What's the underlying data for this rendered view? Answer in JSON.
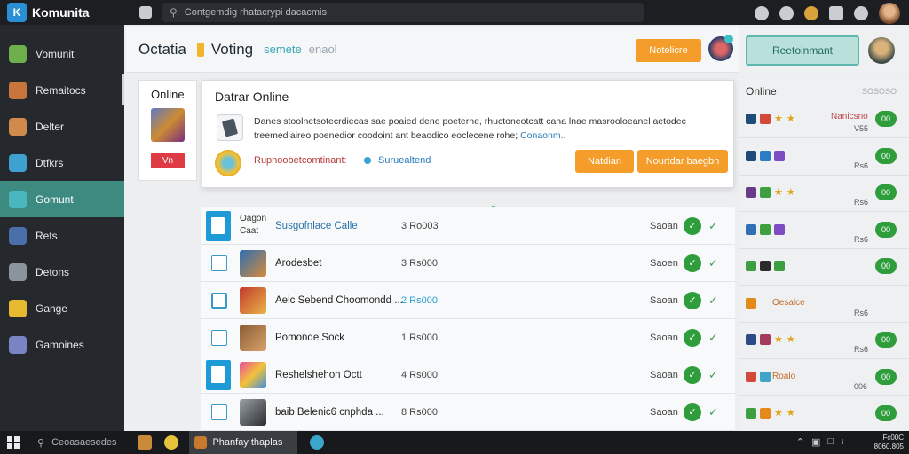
{
  "app": {
    "name": "Komunita"
  },
  "search": {
    "placeholder": "Contgemdig rhatacrypi dacacmis"
  },
  "sidebar": {
    "items": [
      {
        "label": "Vomunit",
        "color": "#6fae4d"
      },
      {
        "label": "Remaitocs",
        "color": "#c7753b"
      },
      {
        "label": "Delter",
        "color": "#d08a4b"
      },
      {
        "label": "Dtfkrs",
        "color": "#3fa1d0"
      },
      {
        "label": "Gomunt",
        "color": "#49b6c0",
        "active": true
      },
      {
        "label": "Rets",
        "color": "#4b6fa8"
      },
      {
        "label": "Detons",
        "color": "#8b949c"
      },
      {
        "label": "Gange",
        "color": "#e6b92e"
      },
      {
        "label": "Gamoines",
        "color": "#7a84c5"
      }
    ]
  },
  "header": {
    "title": "Octatia",
    "section": "Voting",
    "link": "semete",
    "subtext": "enaol",
    "button": "Notelicre"
  },
  "right_top": {
    "button": "Reetoinmant"
  },
  "online_card": {
    "title": "Online",
    "button": "Vn"
  },
  "dialog": {
    "title": "Datrar Online",
    "body": "Danes stoolnetsotecrdiecas sae poaied dene poeterne, rhuctoneotcatt cana lnae masrooloeanel aetodec treemedlaireo poenedior coodoint ant beaodico eoclecene rohe;",
    "link_text": "Conaonm..",
    "note": "Rupnoobetcomtinant:",
    "note_link": "Suruealtend",
    "btn_primary": "Natdian",
    "btn_secondary": "Nourtdar baegbn"
  },
  "list": {
    "rows": [
      {
        "thumb_text": "Oagon\nCaat",
        "name": "Susgofnlace Calle",
        "size": "3 Ro003",
        "status": "Saoan",
        "checkbox": "big",
        "name_blue": true
      },
      {
        "name": "Arodesbet",
        "size": "3 Rs000",
        "status": "Saoen",
        "checkbox": "small",
        "thumb": "linear-gradient(135deg,#2e6fb5,#d48a3b)"
      },
      {
        "name": "Aelc Sebend Choomondd ...",
        "size": "2 Rs000",
        "status": "Saoan",
        "checkbox": "small-thick",
        "size_blue": true,
        "thumb": "linear-gradient(135deg,#c23a2c,#e9b447)"
      },
      {
        "name": "Pomonde Sock",
        "size": "1 Rs000",
        "status": "Saoan",
        "checkbox": "small",
        "thumb": "linear-gradient(135deg,#8a5c34,#d9a36a)"
      },
      {
        "name": "Reshelshehon Octt",
        "size": "4 Rs000",
        "status": "Saoan",
        "checkbox": "big",
        "thumb": "linear-gradient(135deg,#e94e9c,#f3c23a,#3d8de0)"
      },
      {
        "name": "baib Belenic6 cnphda ...",
        "size": "8 Rs000",
        "status": "Saoan",
        "checkbox": "small",
        "thumb": "linear-gradient(135deg,#9aa0a6,#2a2d30)"
      }
    ]
  },
  "right_panel": {
    "title": "Online",
    "title_right": "SOSOSO",
    "rows": [
      {
        "icons": [
          "#1f4b7a",
          "#d34a38",
          "#e3a21a",
          "#e3a21a"
        ],
        "red": "Nanicsno",
        "small": "V55",
        "pill": "00"
      },
      {
        "icons": [
          "#1f4b7a",
          "#2c7bc5",
          "#7e4cc2"
        ],
        "small": "Rs6",
        "pill": "00"
      },
      {
        "icons": [
          "#6a3b8a",
          "#3d9f3f",
          "#e3a21a",
          "#e3a21a"
        ],
        "small": "Rs6",
        "pill": "00"
      },
      {
        "icons": [
          "#2e6fb5",
          "#3d9f3f",
          "#7e4cc2"
        ],
        "small": "Rs6",
        "pill": "00"
      },
      {
        "icons": [
          "#3d9f3f",
          "#2b2b2b",
          "#3d9f3f"
        ],
        "small": "",
        "pill": "00"
      },
      {
        "icons": [
          "#e38a1a"
        ],
        "label": "Oesalce",
        "small": "Rs6",
        "pill": ""
      },
      {
        "icons": [
          "#2e4a88",
          "#a43a5c",
          "#e3a21a",
          "#e3a21a"
        ],
        "small": "Rs6",
        "pill": "00"
      },
      {
        "icons": [
          "#d34a38",
          "#3fa6c9"
        ],
        "label": "Roalo",
        "small": "006",
        "pill": "00"
      },
      {
        "icons": [
          "#3d9f3f",
          "#e38a1a",
          "#e3a21a",
          "#e3a21a"
        ],
        "small": "",
        "pill": "00"
      }
    ]
  },
  "taskbar": {
    "search": "Ceoasaesedes",
    "active_app": "Phanfay thaplas",
    "time": "Fc00C",
    "date": "8060.805"
  },
  "colors": {
    "accent": "#3d8a80",
    "orange": "#f59d2a",
    "green": "#2f9d3c"
  }
}
